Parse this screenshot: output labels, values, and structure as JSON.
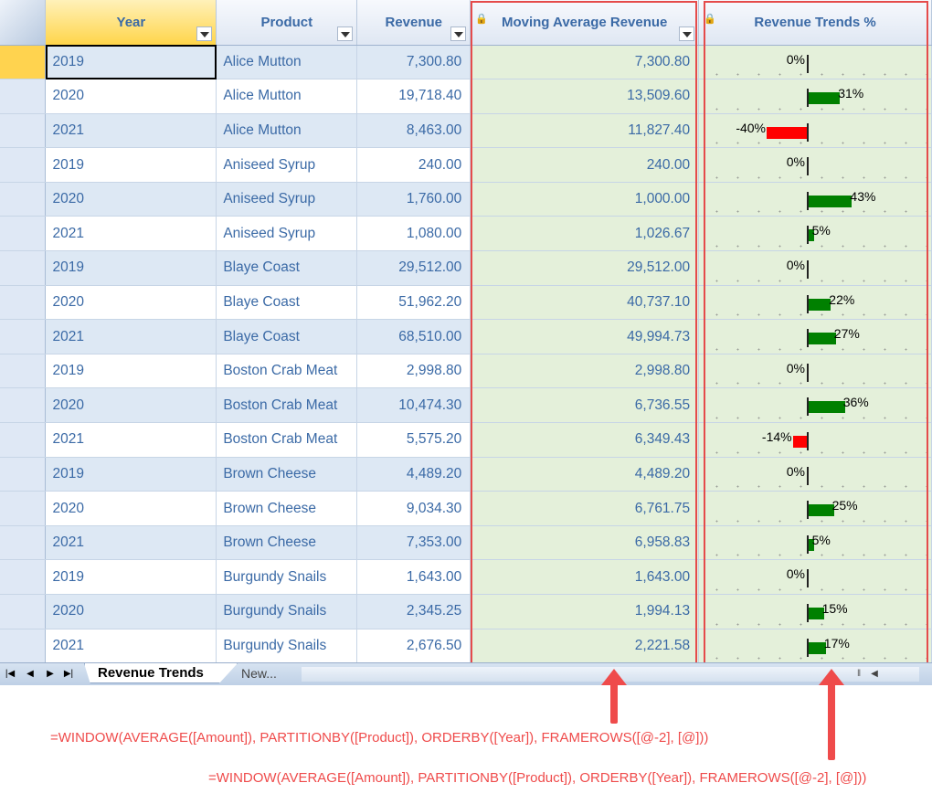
{
  "columns": {
    "year": "Year",
    "product": "Product",
    "revenue": "Revenue",
    "moving_avg": "Moving Average Revenue",
    "trends": "Revenue Trends %"
  },
  "rows": [
    {
      "year": "2019",
      "product": "Alice Mutton",
      "revenue": "7,300.80",
      "moving_avg": "7,300.80",
      "trend": 0
    },
    {
      "year": "2020",
      "product": "Alice Mutton",
      "revenue": "19,718.40",
      "moving_avg": "13,509.60",
      "trend": 31
    },
    {
      "year": "2021",
      "product": "Alice Mutton",
      "revenue": "8,463.00",
      "moving_avg": "11,827.40",
      "trend": -40
    },
    {
      "year": "2019",
      "product": "Aniseed Syrup",
      "revenue": "240.00",
      "moving_avg": "240.00",
      "trend": 0
    },
    {
      "year": "2020",
      "product": "Aniseed Syrup",
      "revenue": "1,760.00",
      "moving_avg": "1,000.00",
      "trend": 43
    },
    {
      "year": "2021",
      "product": "Aniseed Syrup",
      "revenue": "1,080.00",
      "moving_avg": "1,026.67",
      "trend": 5
    },
    {
      "year": "2019",
      "product": "Blaye Coast",
      "revenue": "29,512.00",
      "moving_avg": "29,512.00",
      "trend": 0
    },
    {
      "year": "2020",
      "product": "Blaye Coast",
      "revenue": "51,962.20",
      "moving_avg": "40,737.10",
      "trend": 22
    },
    {
      "year": "2021",
      "product": "Blaye Coast",
      "revenue": "68,510.00",
      "moving_avg": "49,994.73",
      "trend": 27
    },
    {
      "year": "2019",
      "product": "Boston Crab Meat",
      "revenue": "2,998.80",
      "moving_avg": "2,998.80",
      "trend": 0
    },
    {
      "year": "2020",
      "product": "Boston Crab Meat",
      "revenue": "10,474.30",
      "moving_avg": "6,736.55",
      "trend": 36
    },
    {
      "year": "2021",
      "product": "Boston Crab Meat",
      "revenue": "5,575.20",
      "moving_avg": "6,349.43",
      "trend": -14
    },
    {
      "year": "2019",
      "product": "Brown Cheese",
      "revenue": "4,489.20",
      "moving_avg": "4,489.20",
      "trend": 0
    },
    {
      "year": "2020",
      "product": "Brown Cheese",
      "revenue": "9,034.30",
      "moving_avg": "6,761.75",
      "trend": 25
    },
    {
      "year": "2021",
      "product": "Brown Cheese",
      "revenue": "7,353.00",
      "moving_avg": "6,958.83",
      "trend": 5
    },
    {
      "year": "2019",
      "product": "Burgundy Snails",
      "revenue": "1,643.00",
      "moving_avg": "1,643.00",
      "trend": 0
    },
    {
      "year": "2020",
      "product": "Burgundy Snails",
      "revenue": "2,345.25",
      "moving_avg": "1,994.13",
      "trend": 15
    },
    {
      "year": "2021",
      "product": "Burgundy Snails",
      "revenue": "2,676.50",
      "moving_avg": "2,221.58",
      "trend": 17
    }
  ],
  "sheet_tabs": {
    "active": "Revenue Trends",
    "new": "New..."
  },
  "formulas": {
    "moving_avg": "=WINDOW(AVERAGE([Amount]), PARTITIONBY([Product]), ORDERBY([Year]), FRAMEROWS([@-2], [@]))",
    "trends": "=WINDOW(AVERAGE([Amount]), PARTITIONBY([Product]), ORDERBY([Year]), FRAMEROWS([@-2], [@]))"
  },
  "colors": {
    "positive_bar": "#008000",
    "negative_bar": "#ff0000",
    "highlight": "#e54b4b",
    "header_text": "#3b6aa6"
  }
}
